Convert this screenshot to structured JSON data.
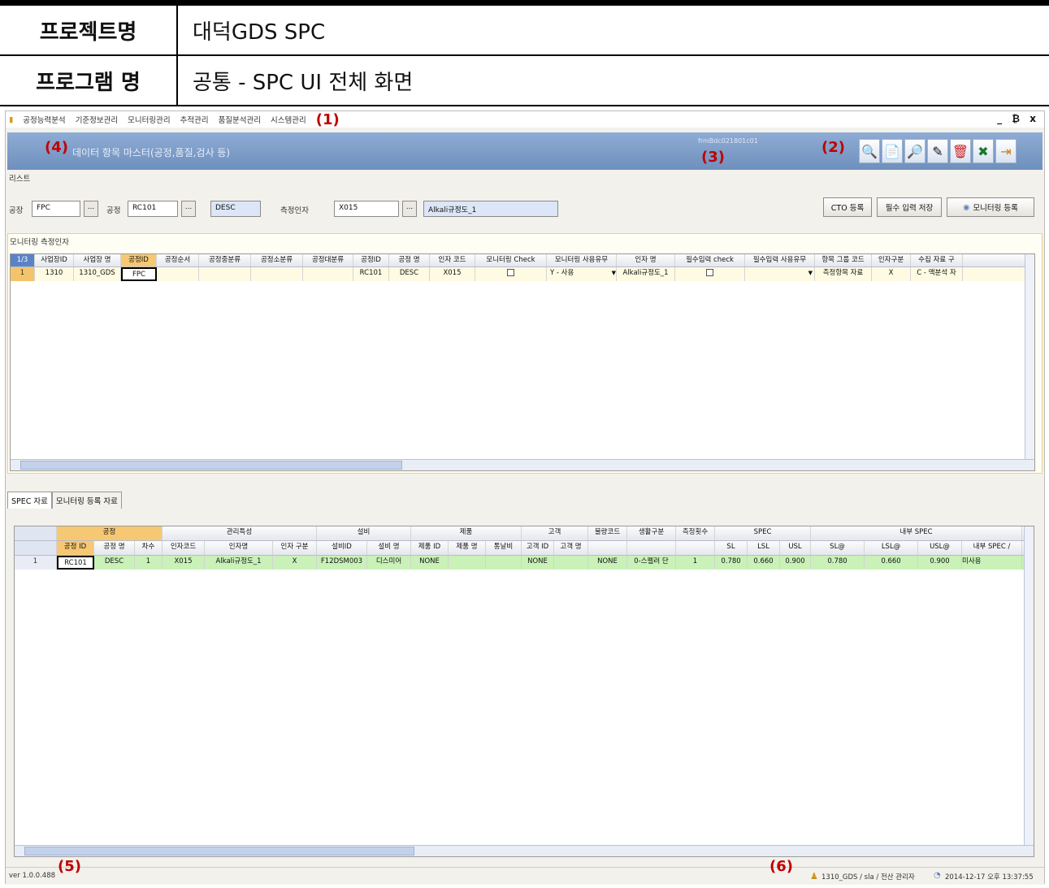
{
  "doc": {
    "project_label": "프로젝트명",
    "project_value": "대덕GDS SPC",
    "program_label": "프로그램 명",
    "program_value": "공통 - SPC UI 전체 화면"
  },
  "markers": [
    "(1)",
    "(2)",
    "(3)",
    "(4)",
    "(5)",
    "(6)"
  ],
  "menu": [
    "공정능력분석",
    "기준정보관리",
    "모니터링관리",
    "추적관리",
    "품질분석관리",
    "시스템관리"
  ],
  "window_controls": "_ ₿ x",
  "title": {
    "text": "데이터 항목 마스터(공정,품질,검사 등)",
    "form_id": "frmBdc021801c01"
  },
  "toolbar_icons": [
    "search-icon",
    "new-icon",
    "view-icon",
    "edit-icon",
    "delete-icon",
    "excel-icon",
    "exit-icon"
  ],
  "list_label": "리스트",
  "filter": {
    "factory_label": "공장",
    "factory_value": "FPC",
    "process_label": "공정",
    "process_value": "RC101",
    "process_name": "DESC",
    "factor_label": "측정인자",
    "factor_value": "X015",
    "factor_name": "Alkali규정도_1",
    "dots": "..."
  },
  "buttons": {
    "cto": "CTO 등록",
    "required_save": "필수 입력 저장",
    "monitor_register": "모니터링 등록"
  },
  "monitor_section": {
    "title": "모니터링 측정인자",
    "columns": [
      "1/3",
      "사업장ID",
      "사업장 명",
      "공정ID",
      "공정순서",
      "공정중분류",
      "공정소분류",
      "공정대분류",
      "공정ID",
      "공정 명",
      "인자 코드",
      "모니터링 Check",
      "모니터링 사용유무",
      "인자 명",
      "필수입력 check",
      "필수입력 사용유무",
      "항목 그룹 코드",
      "인자구분",
      "수집 자료 구"
    ],
    "row": [
      "1",
      "1310",
      "1310_GDS",
      "FPC",
      "",
      "",
      "",
      "",
      "RC101",
      "DESC",
      "X015",
      "",
      "Y - 사용",
      "Alkali규정도_1",
      "",
      "",
      "측정항목 자료",
      "X",
      "C - 맥분석 자"
    ]
  },
  "tabs": [
    "SPEC 자료",
    "모니터링 등록 자료"
  ],
  "spec_grid": {
    "groups": [
      "공정",
      "관리특성",
      "설비",
      "제품",
      "고객",
      "불량코드",
      "생활구분",
      "측정횟수",
      "SPEC",
      "내부 SPEC"
    ],
    "columns": [
      "공정 ID",
      "공정 명",
      "차수",
      "인자코드",
      "인자명",
      "인자 구분",
      "설비ID",
      "설비 명",
      "제품 ID",
      "제품 명",
      "통날비",
      "고객 ID",
      "고객 명",
      "SL",
      "LSL",
      "USL",
      "SL@",
      "LSL@",
      "USL@",
      "내부 SPEC /"
    ],
    "row": [
      "1",
      "RC101",
      "DESC",
      "1",
      "X015",
      "Alkali규정도_1",
      "X",
      "F12DSM003",
      "디스미어",
      "NONE",
      "",
      "",
      "NONE",
      "",
      "NONE",
      "0-스펠러 단",
      "1",
      "0.780",
      "0.660",
      "0.900",
      "0.780",
      "0.660",
      "0.900",
      "미사용"
    ]
  },
  "status": {
    "version": "ver 1.0.0.488",
    "user_info": "1310_GDS / sla / 전산 관리자",
    "timestamp": "2014-12-17 오후 13:37:55"
  }
}
